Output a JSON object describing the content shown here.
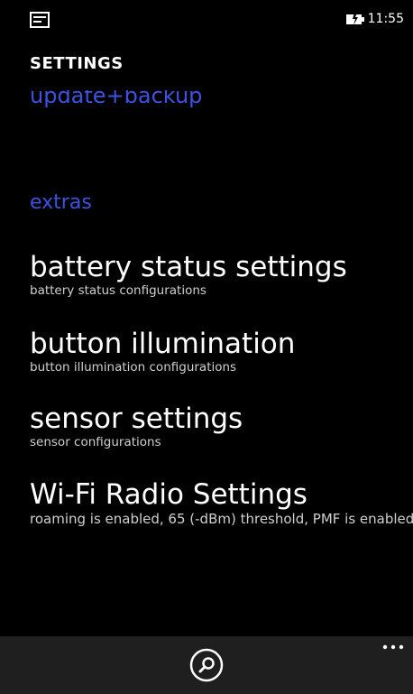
{
  "status_bar": {
    "left_icon": "notification-icon",
    "battery_icon": "battery-charging-icon",
    "time": "11:55"
  },
  "page": {
    "title": "SETTINGS"
  },
  "sections": {
    "update_backup": "update+backup",
    "extras": "extras"
  },
  "items": [
    {
      "title": "battery status settings",
      "subtitle": "battery status configurations"
    },
    {
      "title": "button illumination",
      "subtitle": "button illumination configurations"
    },
    {
      "title": "sensor settings",
      "subtitle": "sensor configurations"
    },
    {
      "title": "Wi-Fi Radio Settings",
      "subtitle": "roaming is enabled, 65 (-dBm) threshold, PMF is enabled"
    }
  ],
  "app_bar": {
    "search_icon": "search-icon",
    "more_icon": "more-options-icon"
  },
  "colors": {
    "accent": "#3d52e0",
    "background": "#000000",
    "app_bar": "#1f1f1f"
  }
}
